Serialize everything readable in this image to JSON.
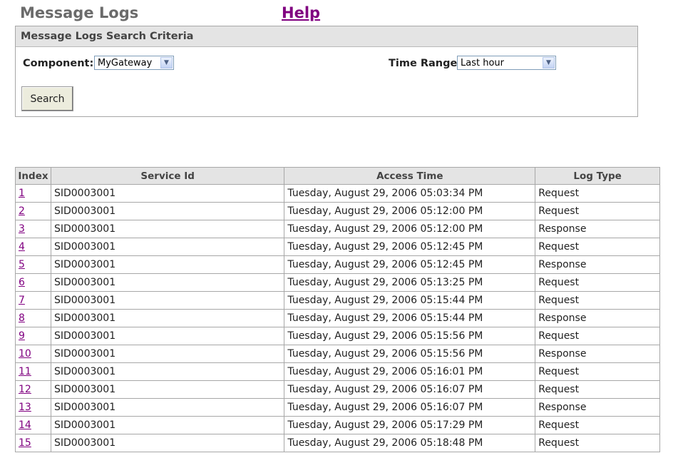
{
  "header": {
    "title": "Message Logs",
    "help_label": "Help"
  },
  "criteria": {
    "title": "Message Logs Search Criteria",
    "component_label": "Component:",
    "component_value": "MyGateway",
    "time_range_label": "Time Range:",
    "time_range_value": "Last hour",
    "search_label": "Search"
  },
  "table": {
    "columns": [
      "Index",
      "Service Id",
      "Access Time",
      "Log Type"
    ],
    "rows": [
      {
        "index": "1",
        "service_id": "SID0003001",
        "access_time": "Tuesday, August 29, 2006 05:03:34 PM",
        "log_type": "Request"
      },
      {
        "index": "2",
        "service_id": "SID0003001",
        "access_time": "Tuesday, August 29, 2006 05:12:00 PM",
        "log_type": "Request"
      },
      {
        "index": "3",
        "service_id": "SID0003001",
        "access_time": "Tuesday, August 29, 2006 05:12:00 PM",
        "log_type": "Response"
      },
      {
        "index": "4",
        "service_id": "SID0003001",
        "access_time": "Tuesday, August 29, 2006 05:12:45 PM",
        "log_type": "Request"
      },
      {
        "index": "5",
        "service_id": "SID0003001",
        "access_time": "Tuesday, August 29, 2006 05:12:45 PM",
        "log_type": "Response"
      },
      {
        "index": "6",
        "service_id": "SID0003001",
        "access_time": "Tuesday, August 29, 2006 05:13:25 PM",
        "log_type": "Request"
      },
      {
        "index": "7",
        "service_id": "SID0003001",
        "access_time": "Tuesday, August 29, 2006 05:15:44 PM",
        "log_type": "Request"
      },
      {
        "index": "8",
        "service_id": "SID0003001",
        "access_time": "Tuesday, August 29, 2006 05:15:44 PM",
        "log_type": "Response"
      },
      {
        "index": "9",
        "service_id": "SID0003001",
        "access_time": "Tuesday, August 29, 2006 05:15:56 PM",
        "log_type": "Request"
      },
      {
        "index": "10",
        "service_id": "SID0003001",
        "access_time": "Tuesday, August 29, 2006 05:15:56 PM",
        "log_type": "Response"
      },
      {
        "index": "11",
        "service_id": "SID0003001",
        "access_time": "Tuesday, August 29, 2006 05:16:01 PM",
        "log_type": "Request"
      },
      {
        "index": "12",
        "service_id": "SID0003001",
        "access_time": "Tuesday, August 29, 2006 05:16:07 PM",
        "log_type": "Request"
      },
      {
        "index": "13",
        "service_id": "SID0003001",
        "access_time": "Tuesday, August 29, 2006 05:16:07 PM",
        "log_type": "Response"
      },
      {
        "index": "14",
        "service_id": "SID0003001",
        "access_time": "Tuesday, August 29, 2006 05:17:29 PM",
        "log_type": "Request"
      },
      {
        "index": "15",
        "service_id": "SID0003001",
        "access_time": "Tuesday, August 29, 2006 05:18:48 PM",
        "log_type": "Request"
      }
    ]
  },
  "colors": {
    "link": "#800080",
    "title": "#6b6b6b",
    "header_bg": "#e4e4e4",
    "border": "#a7a7a7"
  },
  "icons": {
    "dropdown": "chevron-down-icon"
  }
}
